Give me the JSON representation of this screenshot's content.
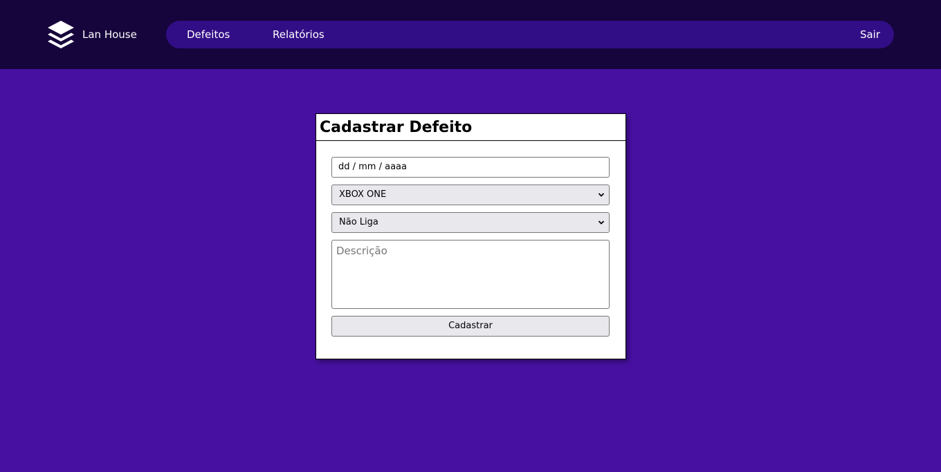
{
  "brand": {
    "name": "Lan House",
    "icon": "stack-layers-icon"
  },
  "nav": {
    "defeitos": "Defeitos",
    "relatorios": "Relatórios",
    "sair": "Sair"
  },
  "form": {
    "title": "Cadastrar Defeito",
    "date_placeholder": "dd / mm / aaaa",
    "console_selected": "XBOX ONE",
    "defect_selected": "Não Liga",
    "description_placeholder": "Descrição",
    "submit_label": "Cadastrar"
  },
  "colors": {
    "page_background": "#4710a1",
    "topbar": "#16043c",
    "nav_pill": "#320e86"
  }
}
